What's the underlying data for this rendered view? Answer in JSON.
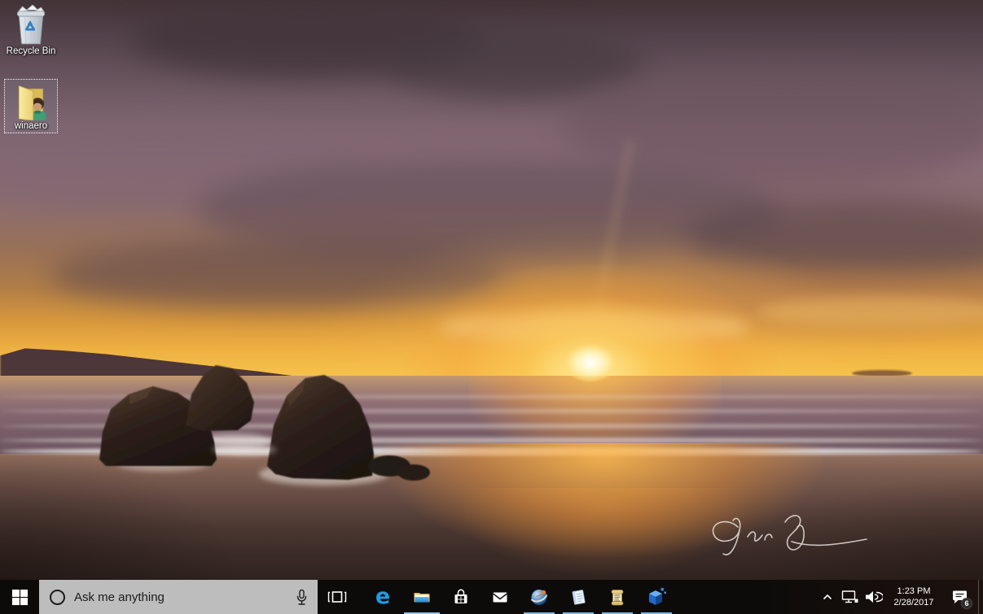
{
  "desktop": {
    "icons": [
      {
        "label": "Recycle Bin"
      },
      {
        "label": "winaero"
      }
    ]
  },
  "taskbar": {
    "search": {
      "placeholder": "Ask me anything"
    },
    "apps": [
      "task-view",
      "edge",
      "file-explorer",
      "store",
      "mail",
      "globe-browser",
      "notepad",
      "wordpad-scroll",
      "winaero-tweaker"
    ],
    "running_apps": [
      "file-explorer",
      "globe-browser",
      "notepad",
      "wordpad-scroll",
      "winaero-tweaker"
    ],
    "tray": {
      "icons": [
        "show-hidden-icons-chevron",
        "network",
        "volume",
        "action-center"
      ],
      "time": "1:23 PM",
      "date": "2/28/2017",
      "notification_count": "6"
    }
  },
  "colors": {
    "taskbar_bg": "#0d0b0a",
    "search_box_bg": "#bdbdbe",
    "running_indicator": "#7ab7e8",
    "selection_border_dotted": "#ffffff",
    "desktop_label_text": "#ffffff"
  }
}
